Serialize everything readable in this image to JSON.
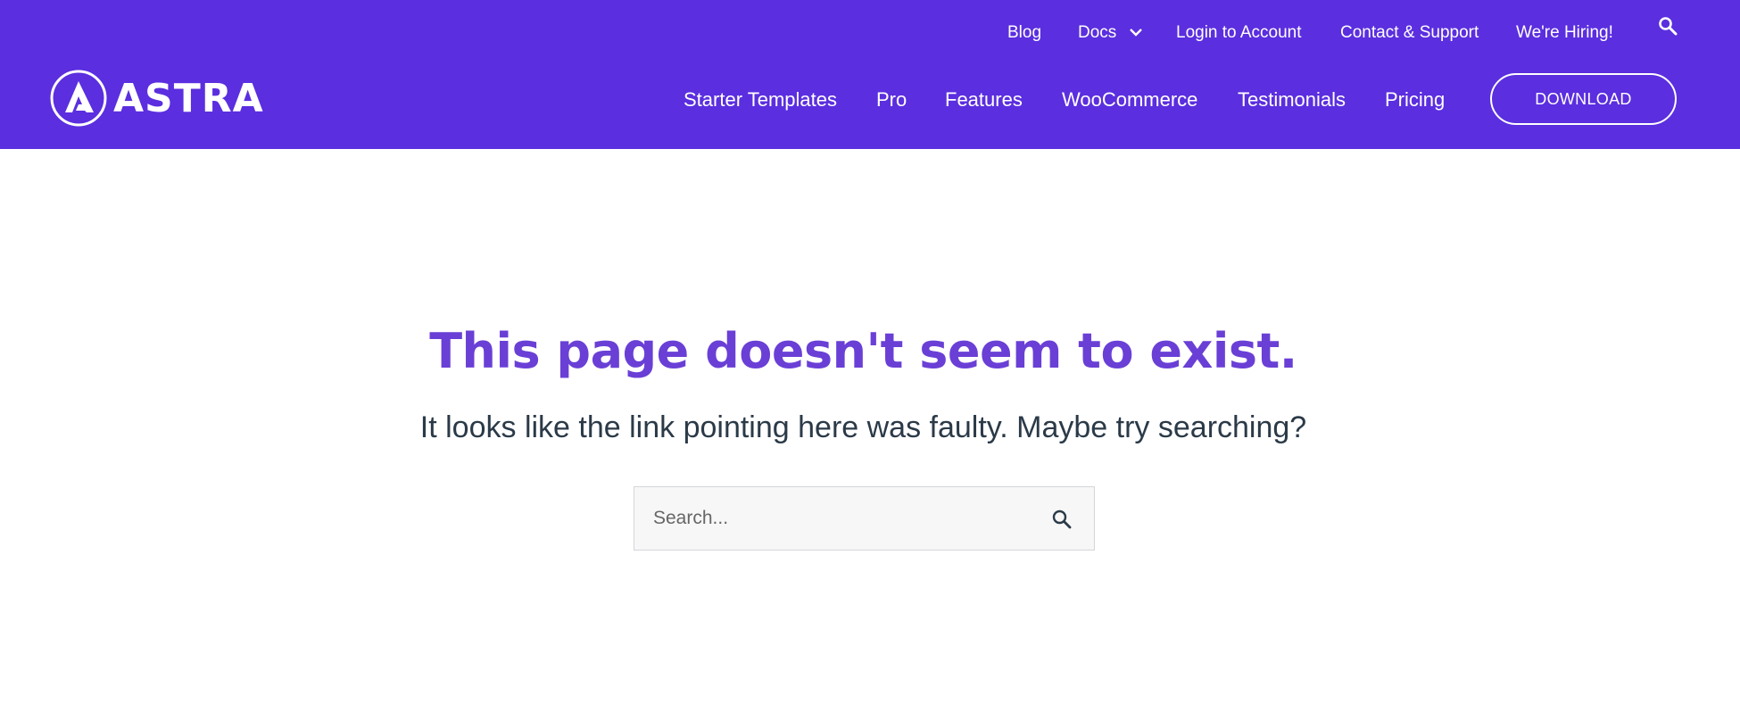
{
  "colors": {
    "header_bg": "#5b2edf",
    "headline": "#6a3fd6",
    "body_text": "#2b3a48",
    "search_bg": "#f7f7f7"
  },
  "topbar": {
    "blog": "Blog",
    "docs": "Docs",
    "login": "Login to Account",
    "contact": "Contact & Support",
    "hiring": "We're Hiring!",
    "search_icon": "search-icon",
    "docs_icon": "chevron-down-icon"
  },
  "logo": {
    "text": "ASTRA",
    "icon": "astra-logo-icon"
  },
  "nav": {
    "starter_templates": "Starter Templates",
    "pro": "Pro",
    "features": "Features",
    "woocommerce": "WooCommerce",
    "testimonials": "Testimonials",
    "pricing": "Pricing",
    "download": "DOWNLOAD"
  },
  "main": {
    "headline": "This page doesn't seem to exist.",
    "subline": "It looks like the link pointing here was faulty. Maybe try searching?",
    "search_placeholder": "Search...",
    "search_button_icon": "search-icon"
  }
}
